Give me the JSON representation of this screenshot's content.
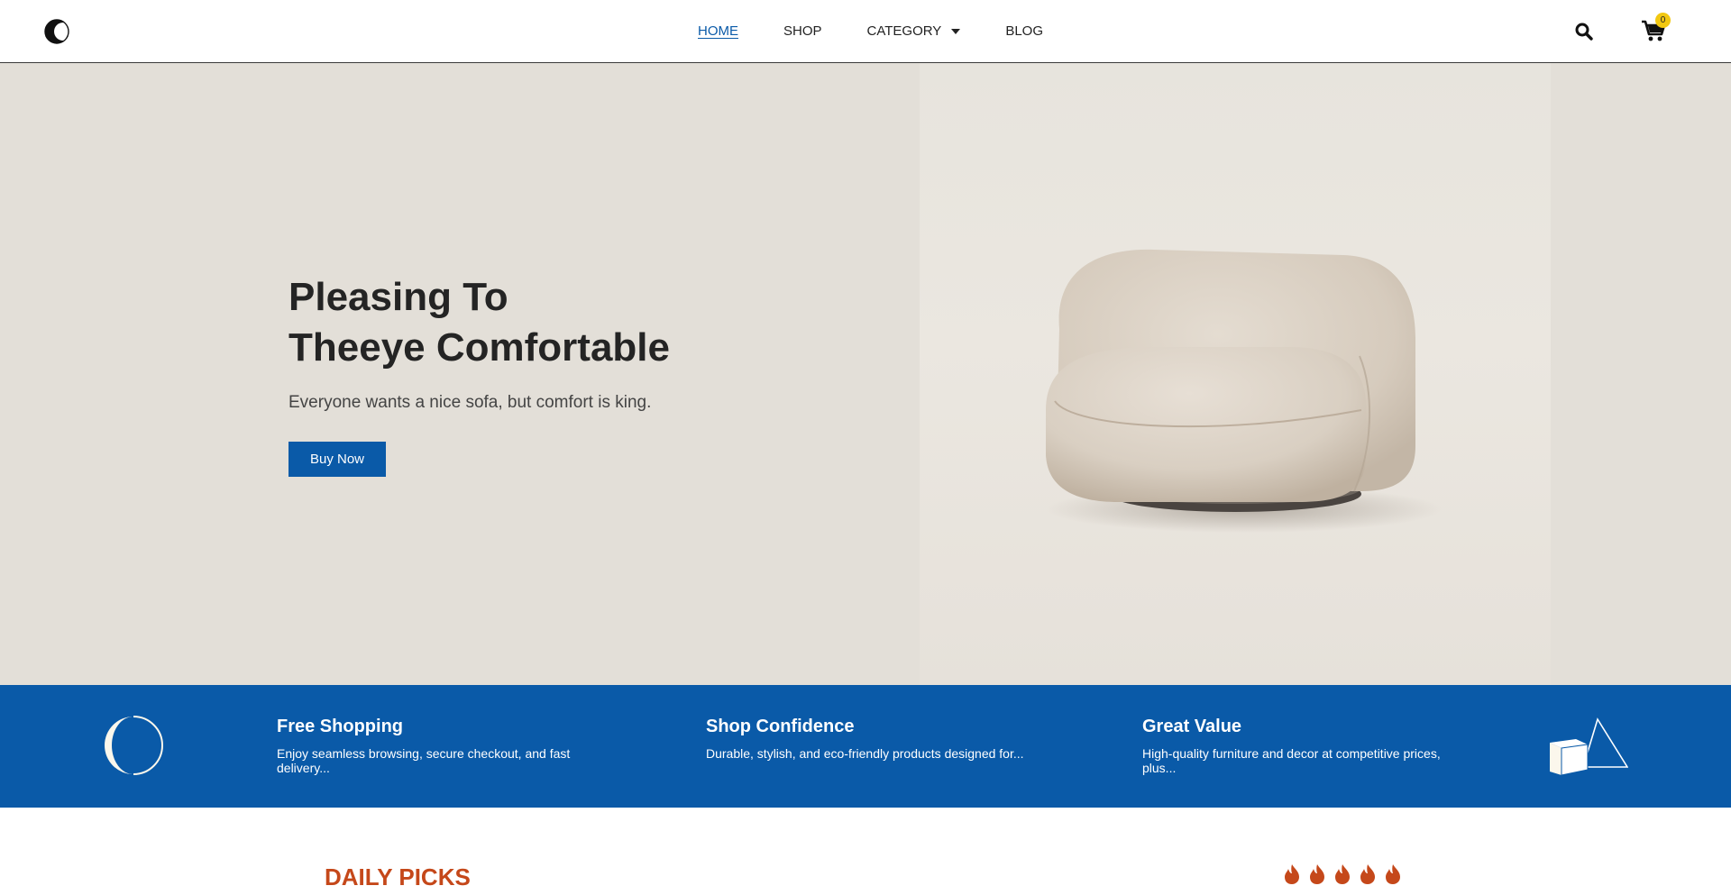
{
  "header": {
    "logo_icon": "crescent-moon-logo",
    "nav": [
      {
        "label": "HOME",
        "active": true
      },
      {
        "label": "SHOP",
        "active": false
      },
      {
        "label": "CATEGORY",
        "active": false,
        "dropdown": true
      },
      {
        "label": "BLOG",
        "active": false
      }
    ],
    "search_icon": "search-icon",
    "cart_icon": "cart-icon",
    "cart_count": "0"
  },
  "hero": {
    "title_line1": "Pleasing To",
    "title_line2": "Theeye Comfortable",
    "subtitle": "Everyone wants a nice sofa, but comfort is king.",
    "button_label": "Buy Now",
    "image": "armchair-image"
  },
  "features": {
    "items": [
      {
        "title": "Free Shopping",
        "text": "Enjoy seamless browsing, secure checkout, and fast delivery..."
      },
      {
        "title": "Shop Confidence",
        "text": "Durable, stylish, and eco-friendly products designed for..."
      },
      {
        "title": "Great Value",
        "text": "High-quality furniture and decor at competitive prices, plus..."
      }
    ]
  },
  "daily_picks": {
    "title": "DAILY PICKS",
    "icon": "flame-icon"
  },
  "colors": {
    "primary": "#0a5aa8",
    "hero_bg": "#e3dfd8",
    "accent": "#c5481a",
    "badge": "#f2c811"
  }
}
